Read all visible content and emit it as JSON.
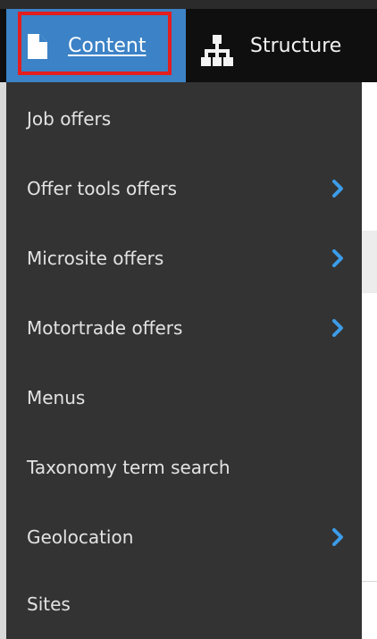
{
  "toolbar": {
    "tabs": [
      {
        "label": "Content",
        "icon": "file-icon",
        "active": true
      },
      {
        "label": "Structure",
        "icon": "sitemap-icon",
        "active": false
      }
    ]
  },
  "menu": {
    "items": [
      {
        "label": "Job offers",
        "has_submenu": false
      },
      {
        "label": "Offer tools offers",
        "has_submenu": true
      },
      {
        "label": "Microsite offers",
        "has_submenu": true
      },
      {
        "label": "Motortrade offers",
        "has_submenu": true
      },
      {
        "label": "Menus",
        "has_submenu": false
      },
      {
        "label": "Taxonomy term search",
        "has_submenu": false
      },
      {
        "label": "Geolocation",
        "has_submenu": true
      },
      {
        "label": "Sites",
        "has_submenu": false
      }
    ]
  },
  "colors": {
    "toolbar_bg": "#0f0f0f",
    "active_tab_bg": "#3c82c6",
    "highlight_border": "#e31e1e",
    "menu_bg": "#333333",
    "menu_text": "#e3e3e3",
    "chevron": "#3d9ce8"
  }
}
